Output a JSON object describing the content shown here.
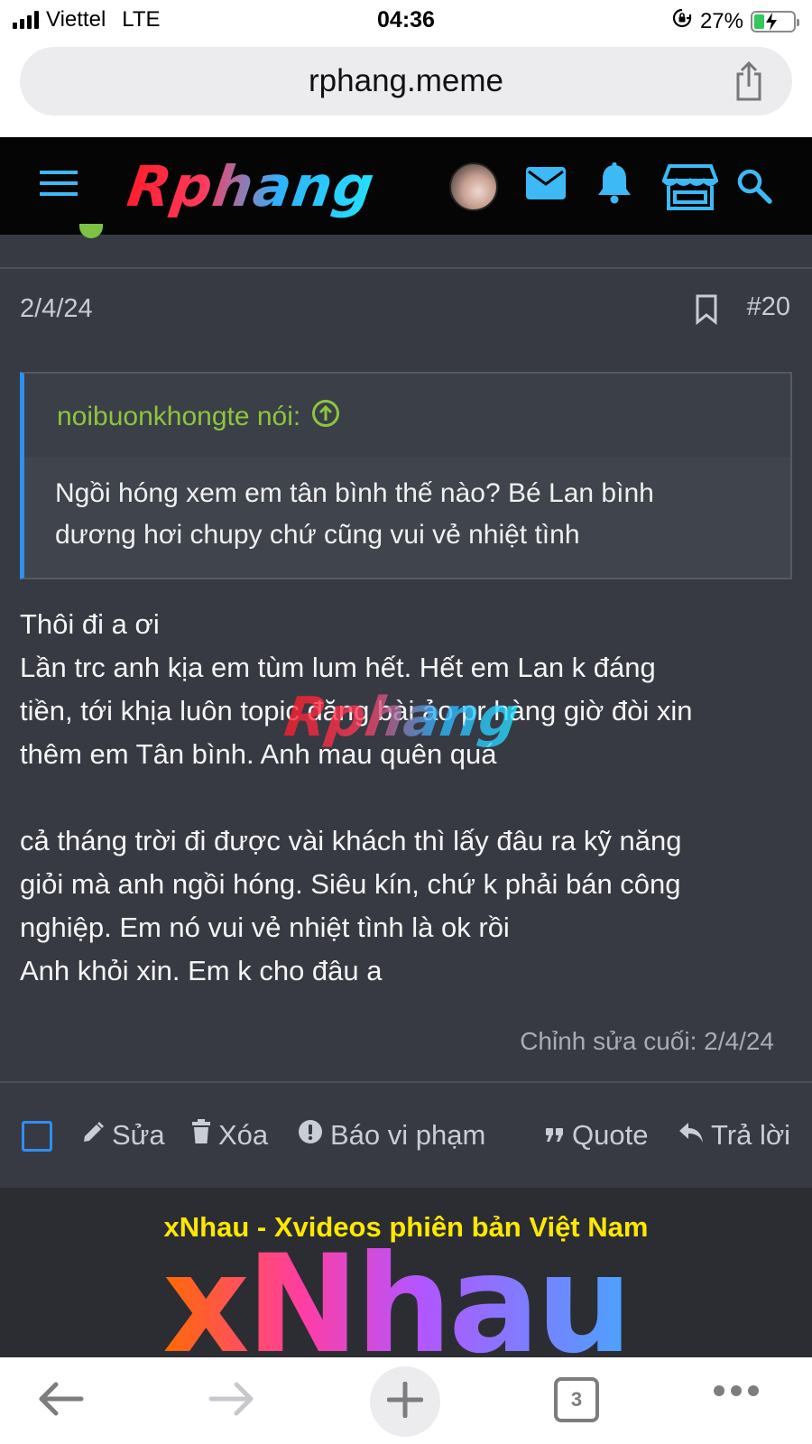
{
  "status_bar": {
    "carrier": "Viettel",
    "network": "LTE",
    "time": "04:36",
    "battery": "27%",
    "battery_level": 0.27
  },
  "browser": {
    "url": "rphang.meme",
    "tab_count": "3"
  },
  "site_header": {
    "logo_text": "Rphang"
  },
  "post": {
    "date": "2/4/24",
    "number": "#20",
    "quote": {
      "author": "noibuonkhongte nói:",
      "text_lines": [
        "Ngồi hóng xem em tân bình thế nào? Bé Lan bình",
        "dương hơi chupy chứ cũng vui vẻ nhiệt tình"
      ]
    },
    "message_lines": [
      "Thôi đi a ơi",
      "Lần trc anh kịa em tùm lum hết. Hết em Lan k đáng",
      "tiền, tới khịa luôn topic đăng bài ảo pr hàng giờ đòi xin",
      "thêm em Tân bình. Anh mau quên quá",
      "",
      "cả tháng trời đi được vài khách thì lấy đâu ra kỹ năng",
      "giỏi mà anh ngồi hóng. Siêu kín, chứ k phải bán công",
      "nghiệp. Em nó vui vẻ nhiệt tình là ok rồi",
      "Anh khỏi xin. Em k cho đâu a"
    ],
    "watermark": "Rphang",
    "last_edited": "Chỉnh sửa cuối: 2/4/24",
    "actions": {
      "edit": "Sửa",
      "delete": "Xóa",
      "report": "Báo vi phạm",
      "quote": "Quote",
      "reply": "Trả lời"
    }
  },
  "ad": {
    "title": "xNhau - Xvideos phiên bản Việt Nam",
    "logo_text": "xNhau"
  },
  "colors": {
    "background": "#373a42",
    "accent_blue": "#2f8ff2",
    "quote_author_green": "#8dc53f",
    "nav_icon_blue": "#3db9f5",
    "ad_title_yellow": "#ffe800"
  },
  "icons": [
    "menu-icon",
    "mail-icon",
    "bell-icon",
    "store-icon",
    "search-icon",
    "bookmark-icon",
    "arrow-up-circle-icon",
    "pencil-icon",
    "trash-icon",
    "alert-icon",
    "quote-icon",
    "reply-icon",
    "share-icon",
    "back-arrow-icon",
    "forward-arrow-icon",
    "plus-icon",
    "more-icon"
  ]
}
